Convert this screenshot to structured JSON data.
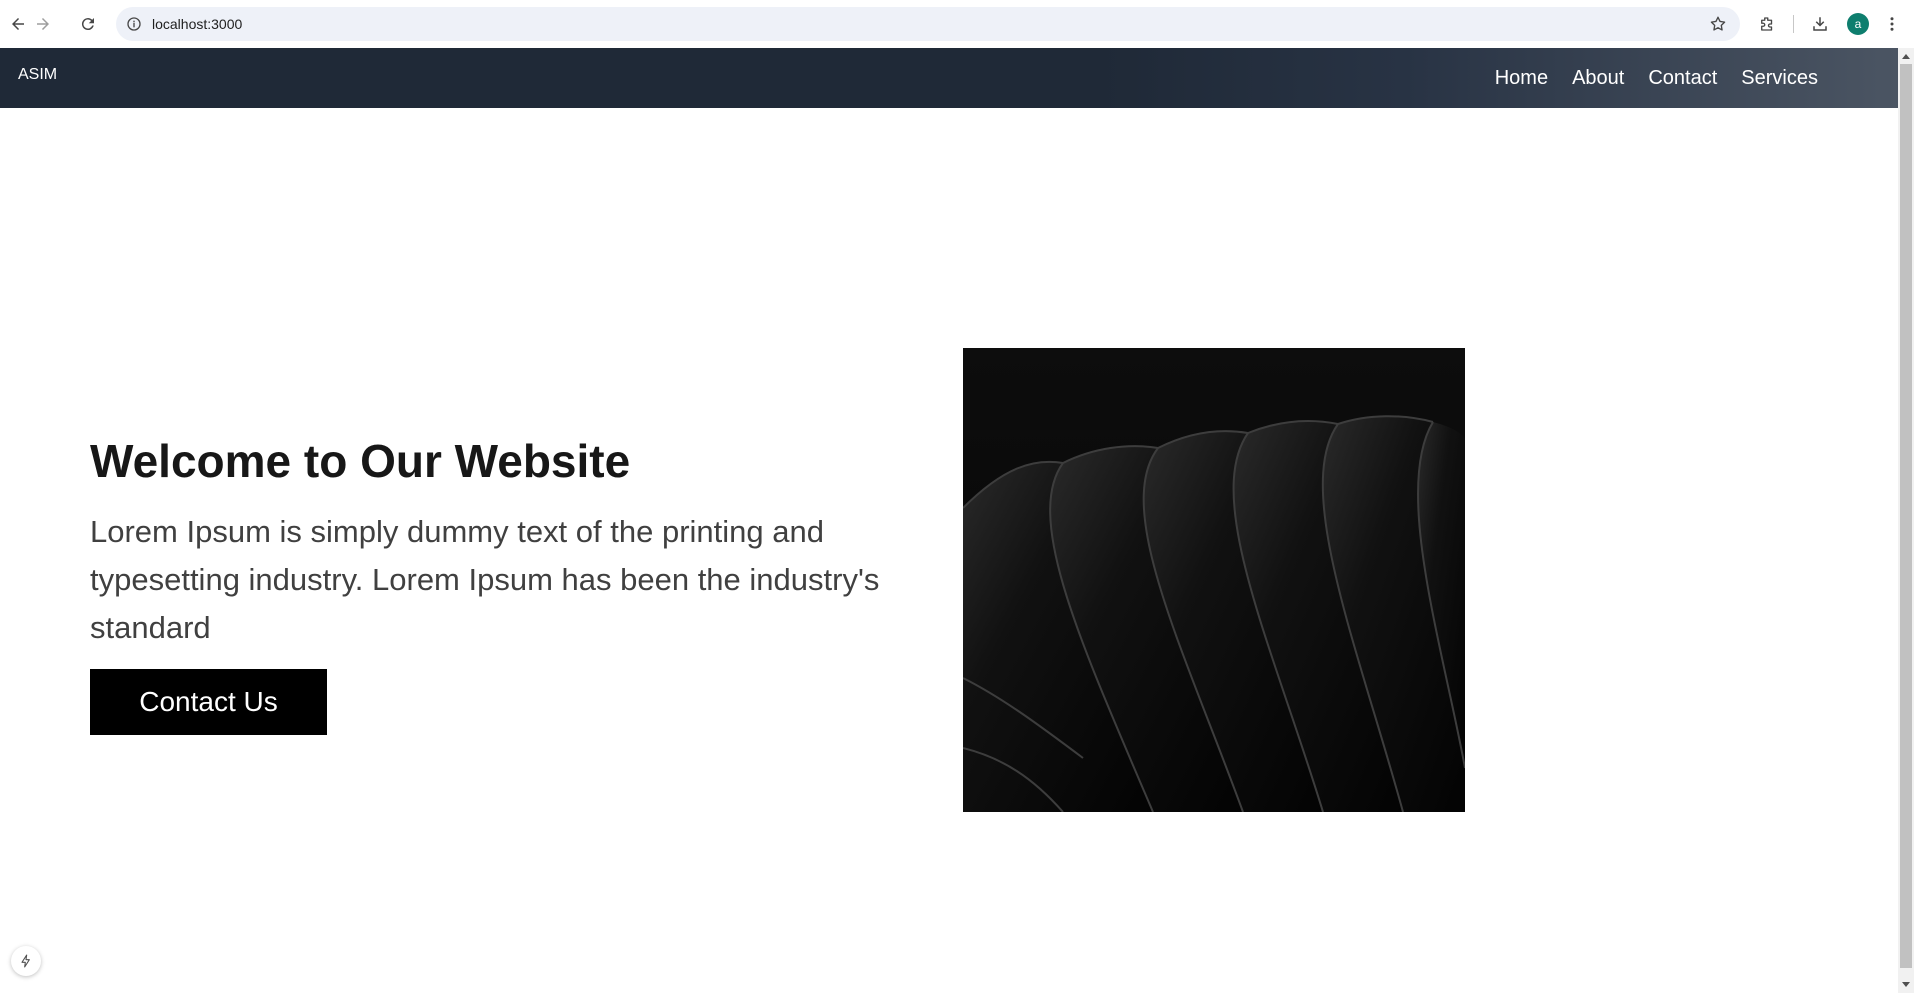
{
  "browser": {
    "url": "localhost:3000",
    "profile_initial": "a",
    "icons": {
      "back": "arrow-left-icon",
      "forward": "arrow-right-icon",
      "reload": "reload-icon",
      "site_info": "info-icon",
      "bookmark": "star-icon",
      "extensions": "puzzle-icon",
      "downloads": "download-icon",
      "menu": "kebab-menu-icon"
    }
  },
  "header": {
    "brand": "ASIM",
    "nav": [
      "Home",
      "About",
      "Contact",
      "Services"
    ]
  },
  "hero": {
    "title": "Welcome to Our Website",
    "text": "Lorem Ipsum is simply dummy text of the printing and typesetting industry. Lorem Ipsum has been the industry's standard",
    "cta_label": "Contact Us",
    "image": "abstract-dark-waves-image"
  },
  "colors": {
    "header_start": "#1f2937",
    "header_end": "#4b5563",
    "button_bg": "#000000",
    "title_text": "#171717",
    "body_text": "#404040",
    "avatar_bg": "#0e7e6e"
  }
}
